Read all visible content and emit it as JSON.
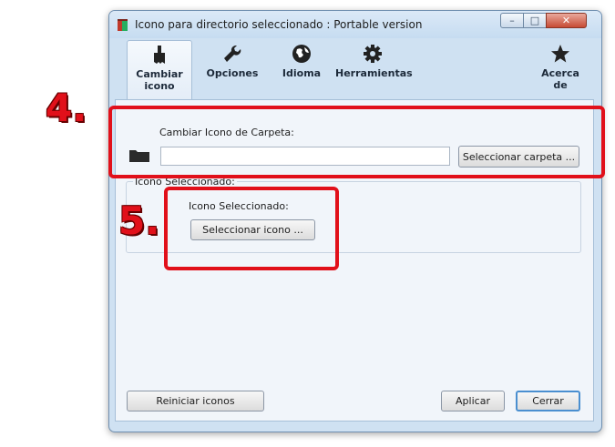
{
  "window": {
    "title": "Icono para directorio seleccionado : Portable version",
    "controls": {
      "minimize": "–",
      "maximize": "□",
      "close": "✕"
    }
  },
  "toolbar": {
    "items": [
      {
        "label": "Cambiar\nicono",
        "icon": "brush-icon",
        "active": true
      },
      {
        "label": "Opciones",
        "icon": "wrench-icon",
        "active": false
      },
      {
        "label": "Idioma",
        "icon": "globe-icon",
        "active": false
      },
      {
        "label": "Herramientas",
        "icon": "gear-icon",
        "active": false
      },
      {
        "label": "Acerca de",
        "icon": "star-icon",
        "active": false
      }
    ]
  },
  "folder_section": {
    "label": "Cambiar Icono de Carpeta:",
    "path_value": "",
    "select_button": "Seleccionar carpeta ..."
  },
  "icon_section": {
    "group_title": "Icono Seleccionado:",
    "label": "Icono Seleccionado:",
    "select_button": "Seleccionar icono ..."
  },
  "footer": {
    "reset_button": "Reiniciar iconos",
    "apply_button": "Aplicar",
    "close_button": "Cerrar"
  },
  "annotations": {
    "step4": "4.",
    "step5": "5.",
    "color": "#e1101a"
  }
}
